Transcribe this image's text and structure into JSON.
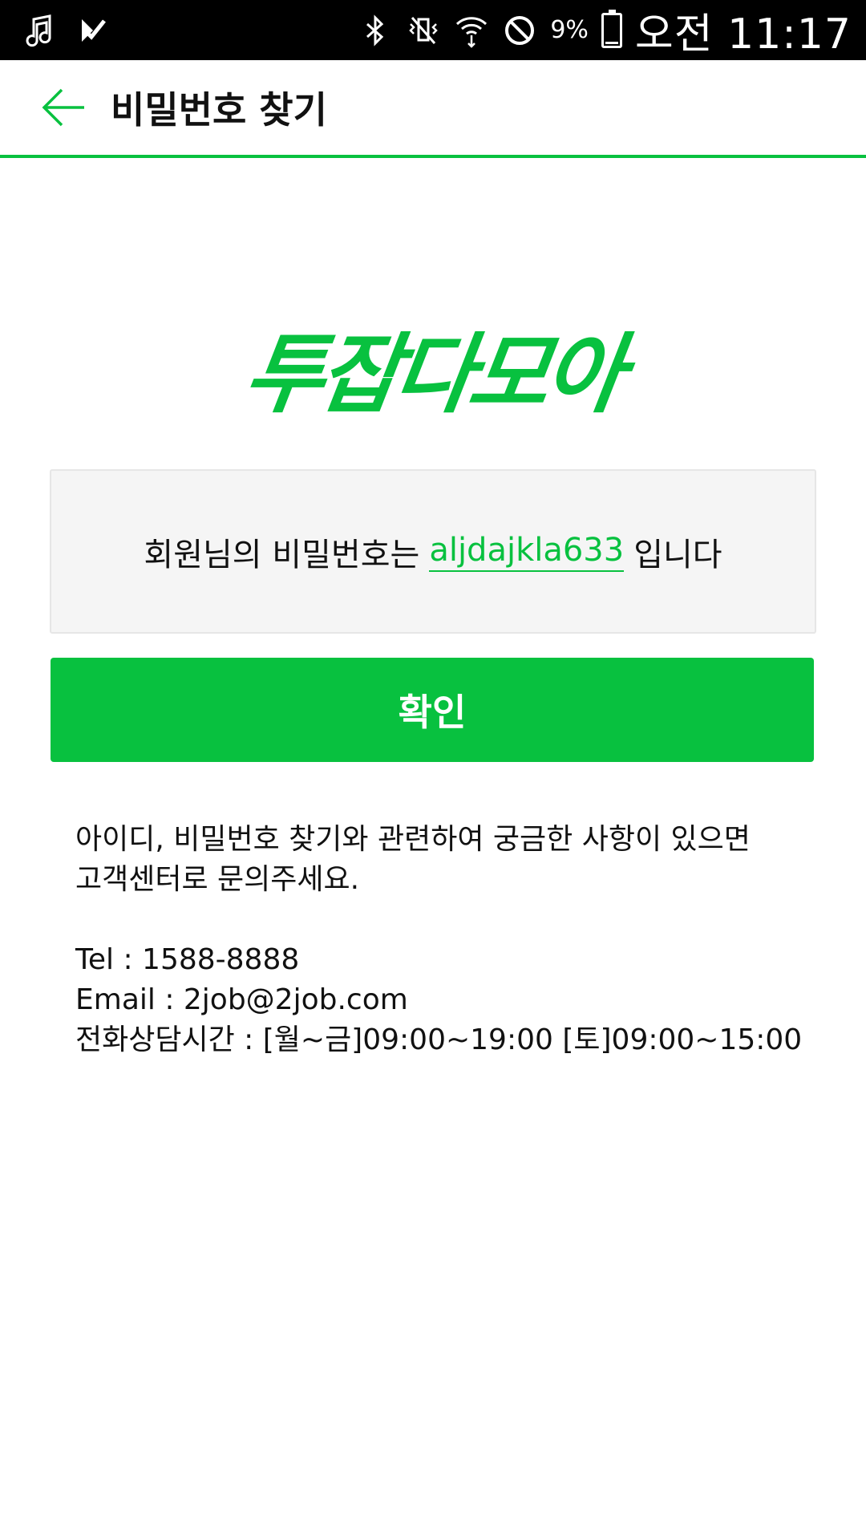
{
  "status_bar": {
    "battery": "9%",
    "time": "오전 11:17"
  },
  "header": {
    "title": "비밀번호 찾기"
  },
  "logo": {
    "text": "투잡다모아"
  },
  "result": {
    "prefix": "회원님의 비밀번호는",
    "password": "aljdajkla633",
    "suffix": "입니다"
  },
  "confirm_label": "확인",
  "help": {
    "line1": "아이디, 비밀번호 찾기와 관련하여 궁금한 사항이 있으면",
    "line2": "고객센터로 문의주세요.",
    "tel": "Tel : 1588-8888",
    "email": "Email : 2job@2job.com",
    "hours": "전화상담시간 : [월~금]09:00~19:00 [토]09:00~15:00"
  },
  "colors": {
    "accent": "#08c13f",
    "box_bg": "#f5f5f5"
  }
}
